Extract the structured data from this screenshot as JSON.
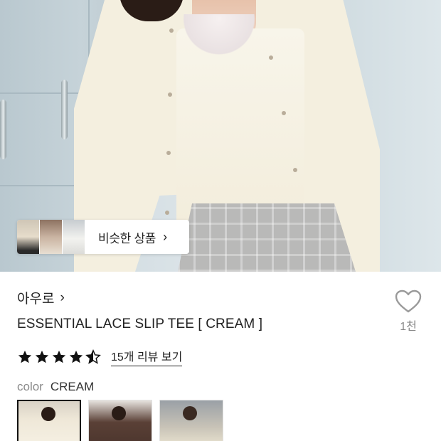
{
  "hero": {
    "image_description_icon": "product-photo",
    "similar_products": {
      "label": "비슷한 상품",
      "chevron": "›",
      "thumbnail_count": 3
    }
  },
  "product": {
    "brand": "아우로",
    "brand_chevron": "›",
    "title": "ESSENTIAL LACE SLIP TEE [ CREAM ]",
    "like": {
      "icon": "heart-outline-icon",
      "count": "1천"
    },
    "rating": {
      "stars": 4.5,
      "max_stars": 5,
      "review_link": "15개 리뷰 보기"
    },
    "color": {
      "label": "color",
      "value": "CREAM"
    },
    "swatches": [
      {
        "name": "cream",
        "selected": true
      },
      {
        "name": "brown",
        "selected": false
      },
      {
        "name": "ivory-alt",
        "selected": false
      }
    ]
  },
  "colors": {
    "text_primary": "#222222",
    "text_muted": "#8a8a8a",
    "star": "#111111",
    "heart_outline": "#999999"
  }
}
